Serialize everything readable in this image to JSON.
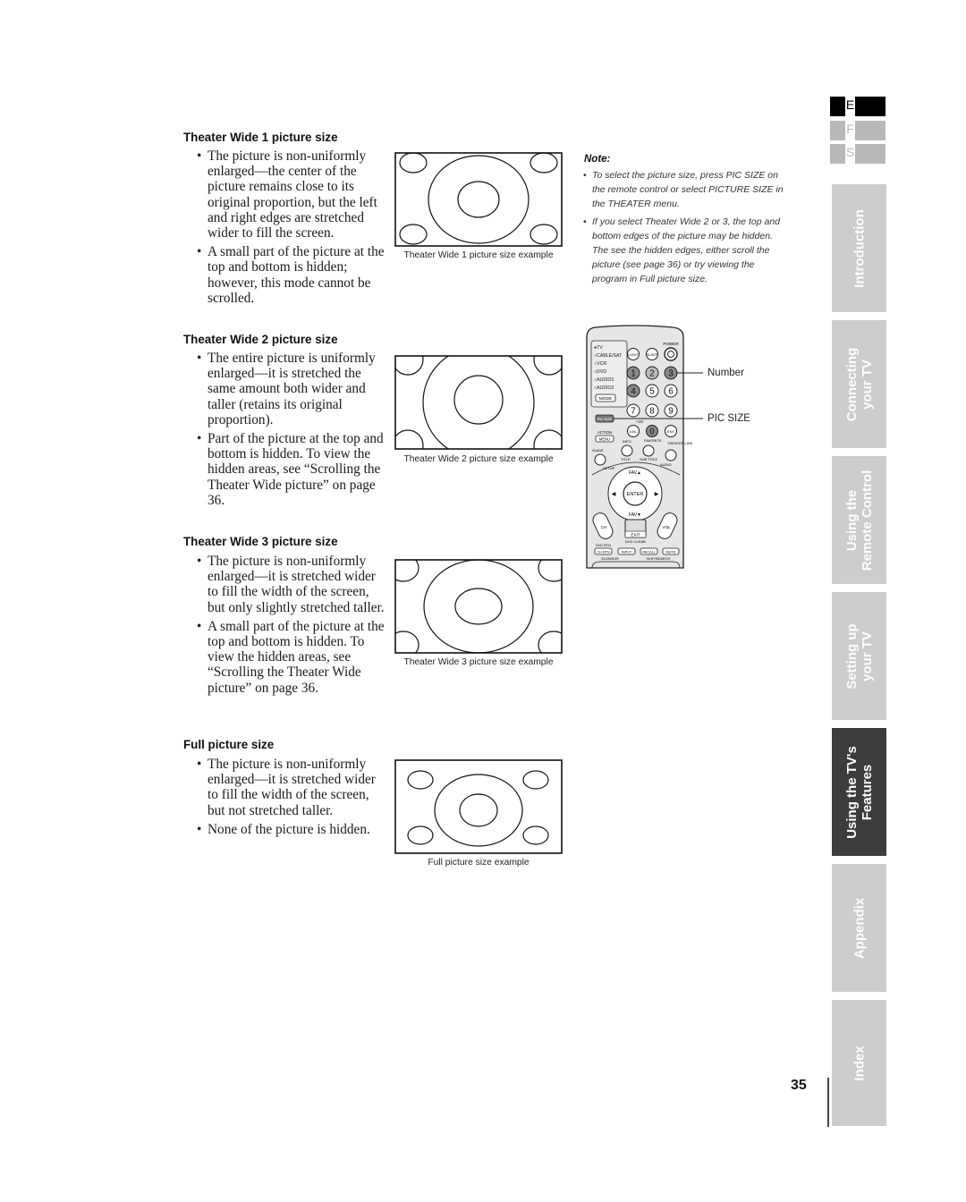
{
  "page_number": "35",
  "language_index": {
    "items": [
      {
        "letter": "E",
        "active": true
      },
      {
        "letter": "F",
        "active": false
      },
      {
        "letter": "S",
        "active": false
      }
    ]
  },
  "side_tabs": [
    {
      "label": "Introduction",
      "active": false
    },
    {
      "label": "Connecting\nyour TV",
      "active": false
    },
    {
      "label": "Using the\nRemote Control",
      "active": false
    },
    {
      "label": "Setting up\nyour TV",
      "active": false
    },
    {
      "label": "Using the TV's\nFeatures",
      "active": true
    },
    {
      "label": "Appendix",
      "active": false
    },
    {
      "label": "Index",
      "active": false
    }
  ],
  "sections": [
    {
      "heading": "Theater Wide 1 picture size",
      "bullets": [
        "The picture is non-uniformly enlarged—the center of the picture remains close to its original proportion, but the left and right edges are stretched wider to fill the screen.",
        "A small part of the picture at the top and bottom is hidden; however, this mode cannot be scrolled."
      ],
      "caption": "Theater Wide 1 picture size example"
    },
    {
      "heading": "Theater Wide 2 picture size",
      "bullets": [
        "The entire picture is uniformly enlarged—it is stretched the same amount both wider and taller (retains its original proportion).",
        "Part of the picture at the top and bottom is hidden. To view the hidden areas, see “Scrolling the Theater Wide picture” on page 36."
      ],
      "caption": "Theater Wide 2 picture size example"
    },
    {
      "heading": "Theater Wide 3 picture size",
      "bullets": [
        "The picture is non-uniformly enlarged—it is stretched wider to fill the width of the screen, but only slightly stretched taller.",
        "A small part of the picture at the top and bottom is hidden. To view the hidden areas, see “Scrolling the Theater Wide picture” on page 36."
      ],
      "caption": "Theater Wide 3 picture size example"
    },
    {
      "heading": "Full picture size",
      "bullets": [
        "The picture is non-uniformly enlarged—it is stretched wider to fill the width of  the screen, but not stretched taller.",
        "None of the picture is hidden."
      ],
      "caption": "Full picture size example"
    }
  ],
  "note": {
    "title": "Note:",
    "items": [
      "To select the picture size, press PIC SIZE on the remote control or select PICTURE SIZE in the THEATER menu.",
      "If you select Theater Wide 2 or 3, the top and bottom edges of the picture may be hidden. The see the hidden edges, either scroll the picture (see page 36) or try viewing the program in Full picture size."
    ]
  },
  "remote": {
    "callouts": {
      "number": "Number",
      "pic_size": "PIC SIZE"
    },
    "modes": [
      "TV",
      "CABLE/SAT",
      "VCR",
      "DVD",
      "AUDIO1",
      "AUDIO2"
    ],
    "mode_button": "MODE",
    "power": "POWER",
    "light": "LIGHT",
    "sleep": "SLEEP",
    "digits": [
      "1",
      "2",
      "3",
      "4",
      "5",
      "6",
      "7",
      "8",
      "9"
    ],
    "picsize": "PIC SIZE",
    "plus10": "+10",
    "hundred": "100/-",
    "zero": "0",
    "ent": "ENT",
    "action": "ACTION",
    "menu": "MENU",
    "info": "INFO",
    "favorite": "FAVORITE",
    "theater_link": "THEATER LINK",
    "guide": "GUIDE",
    "title": "TITLE",
    "subtitle": "SUB TITLE",
    "audio": "AUDIO",
    "setup": "SETUP",
    "fav_up": "FAV▲",
    "fav_down": "FAV▼",
    "enter": "ENTER",
    "ch": "CH",
    "vol": "VOL",
    "exit": "EXIT",
    "dvd_clear": "DVD CLEAR",
    "dvd_rtn": "DVD RTN",
    "ch_rtn": "CH RTN",
    "input": "INPUT",
    "recall": "RECALL",
    "mute": "MUTE",
    "slow_dir": "SLOW/DIR",
    "skip_search": "SKIP/SEARCH"
  }
}
